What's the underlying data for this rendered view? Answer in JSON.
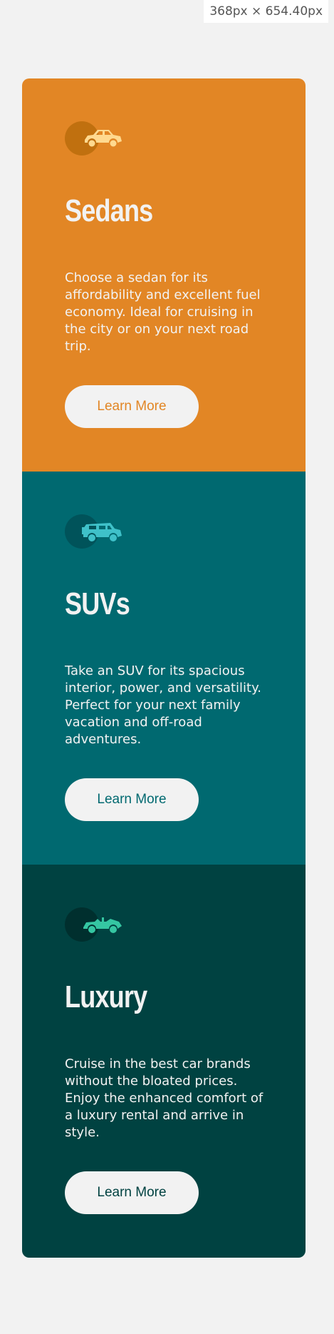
{
  "viewport_badge": "368px × 654.40px",
  "cards": [
    {
      "title": "Sedans",
      "description": "Choose a sedan for its affordability and excellent fuel economy. Ideal for cruising in the city or on your next road trip.",
      "button_label": "Learn More",
      "icon": "sedan-car-icon",
      "colors": {
        "background": "#e28625",
        "title": "#f2f2f2",
        "text": "#f2f2f2",
        "button_text": "#e28625",
        "icon": "#ffd98f",
        "icon_circle": "#c0700f"
      }
    },
    {
      "title": "SUVs",
      "description": "Take an SUV for its spacious interior, power, and versatility. Perfect for your next family vacation and off-road adventures.",
      "button_label": "Learn More",
      "icon": "suv-car-icon",
      "colors": {
        "background": "#006970",
        "title": "#f2f2f2",
        "text": "#f2f2f2",
        "button_text": "#006970",
        "icon": "#3fc1c9",
        "icon_circle": "#00535a"
      }
    },
    {
      "title": "Luxury",
      "description": "Cruise in the best car brands without the bloated prices. Enjoy the enhanced comfort of a luxury rental and arrive in style.",
      "button_label": "Learn More",
      "icon": "luxury-car-icon",
      "colors": {
        "background": "#004241",
        "title": "#f2f2f2",
        "text": "#f2f2f2",
        "button_text": "#004241",
        "icon": "#35c6a2",
        "icon_circle": "#002f2e"
      }
    }
  ]
}
